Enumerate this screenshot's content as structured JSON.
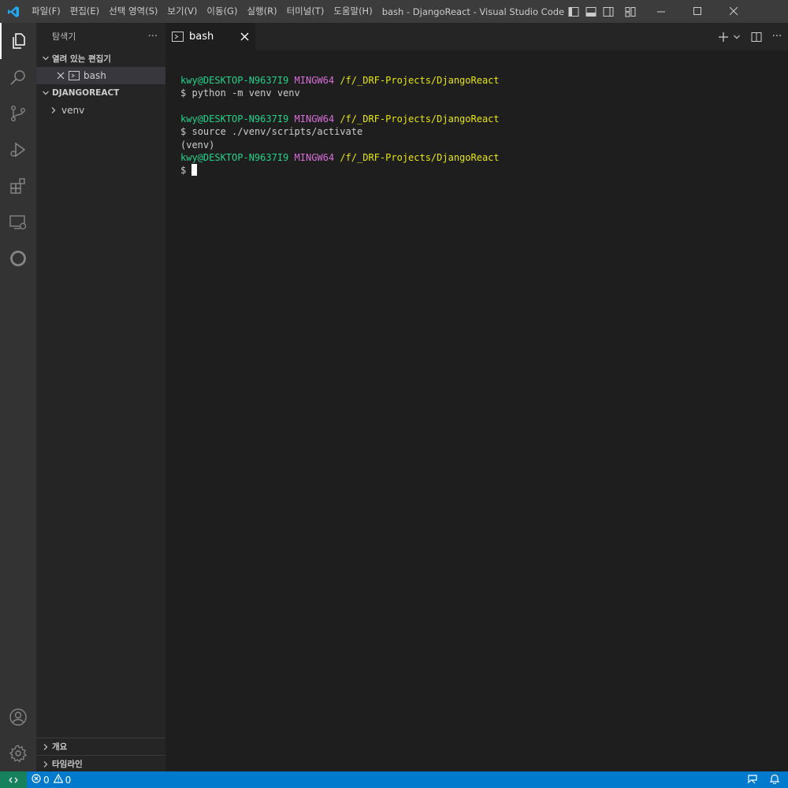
{
  "titlebar": {
    "menu": [
      "파일(F)",
      "편집(E)",
      "선택 영역(S)",
      "보기(V)",
      "이동(G)",
      "실행(R)",
      "터미널(T)",
      "도움말(H)"
    ],
    "window_title": "bash - DjangoReact - Visual Studio Code [관..."
  },
  "sidebar": {
    "title": "탐색기",
    "more": "···",
    "open_editors_label": "열려 있는 편집기",
    "open_editors": [
      {
        "name": "bash",
        "icon": "terminal-icon"
      }
    ],
    "project_label": "DJANGOREACT",
    "folders": [
      {
        "name": "venv"
      }
    ],
    "outline_label": "개요",
    "timeline_label": "타임라인"
  },
  "tab": {
    "label": "bash",
    "icon": "terminal-icon"
  },
  "terminal": {
    "user": "kwy@DESKTOP-N9637I9",
    "shell": "MINGW64",
    "path": "/f/_DRF-Projects/DjangoReact",
    "prompt": "$",
    "cmd1": "python -m venv venv",
    "cmd2": "source ./venv/scripts/activate",
    "venv": "(venv)"
  },
  "statusbar": {
    "errors": "0",
    "warnings": "0"
  },
  "colors": {
    "accent": "#007acc",
    "remote": "#16825d",
    "user": "#23d18b",
    "shell": "#d670d6",
    "path": "#e5e510"
  }
}
